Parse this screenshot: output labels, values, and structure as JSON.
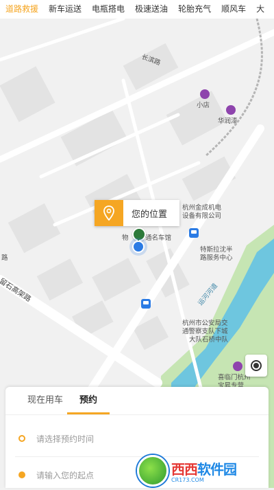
{
  "top_tabs": [
    "道路救援",
    "新车运送",
    "电瓶搭电",
    "极速送油",
    "轮胎充气",
    "顺风车",
    "大"
  ],
  "map": {
    "labels": {
      "road_changbin": "长滨路",
      "shop": "小店",
      "huarunqi": "华润漆",
      "company_1": "杭州金成机电",
      "company_2": "设备有限公司",
      "wuliu_1": "物",
      "wuliu_2": "通名车馆",
      "tesla_1": "特斯拉沈半",
      "tesla_2": "路服务中心",
      "river": "运河河道",
      "overpass": "留石高架路",
      "road_left": "路",
      "police_1": "杭州市公安局交",
      "police_2": "通警察支队下城",
      "police_3": "大队石桥中队",
      "bottom_place_1": "喜临门杭州",
      "bottom_place_2": "宝昇专营"
    }
  },
  "location_card": {
    "text": "您的位置"
  },
  "panel": {
    "tabs": [
      "现在用车",
      "预约"
    ],
    "active_tab": "预约",
    "time_placeholder": "请选择预约时间",
    "start_placeholder": "请输入您的起点"
  },
  "watermark": {
    "main_a": "西西",
    "main_b": "软件园",
    "sub": "CR173.COM"
  },
  "colors": {
    "accent": "#f5a623",
    "bus": "#2b7be4",
    "water": "#6ec6df",
    "green": "#c6e5b3"
  },
  "icons": {
    "location_card": "pin-icon",
    "locate": "locate-icon",
    "time": "clock-icon",
    "start": "start-dot-icon"
  }
}
